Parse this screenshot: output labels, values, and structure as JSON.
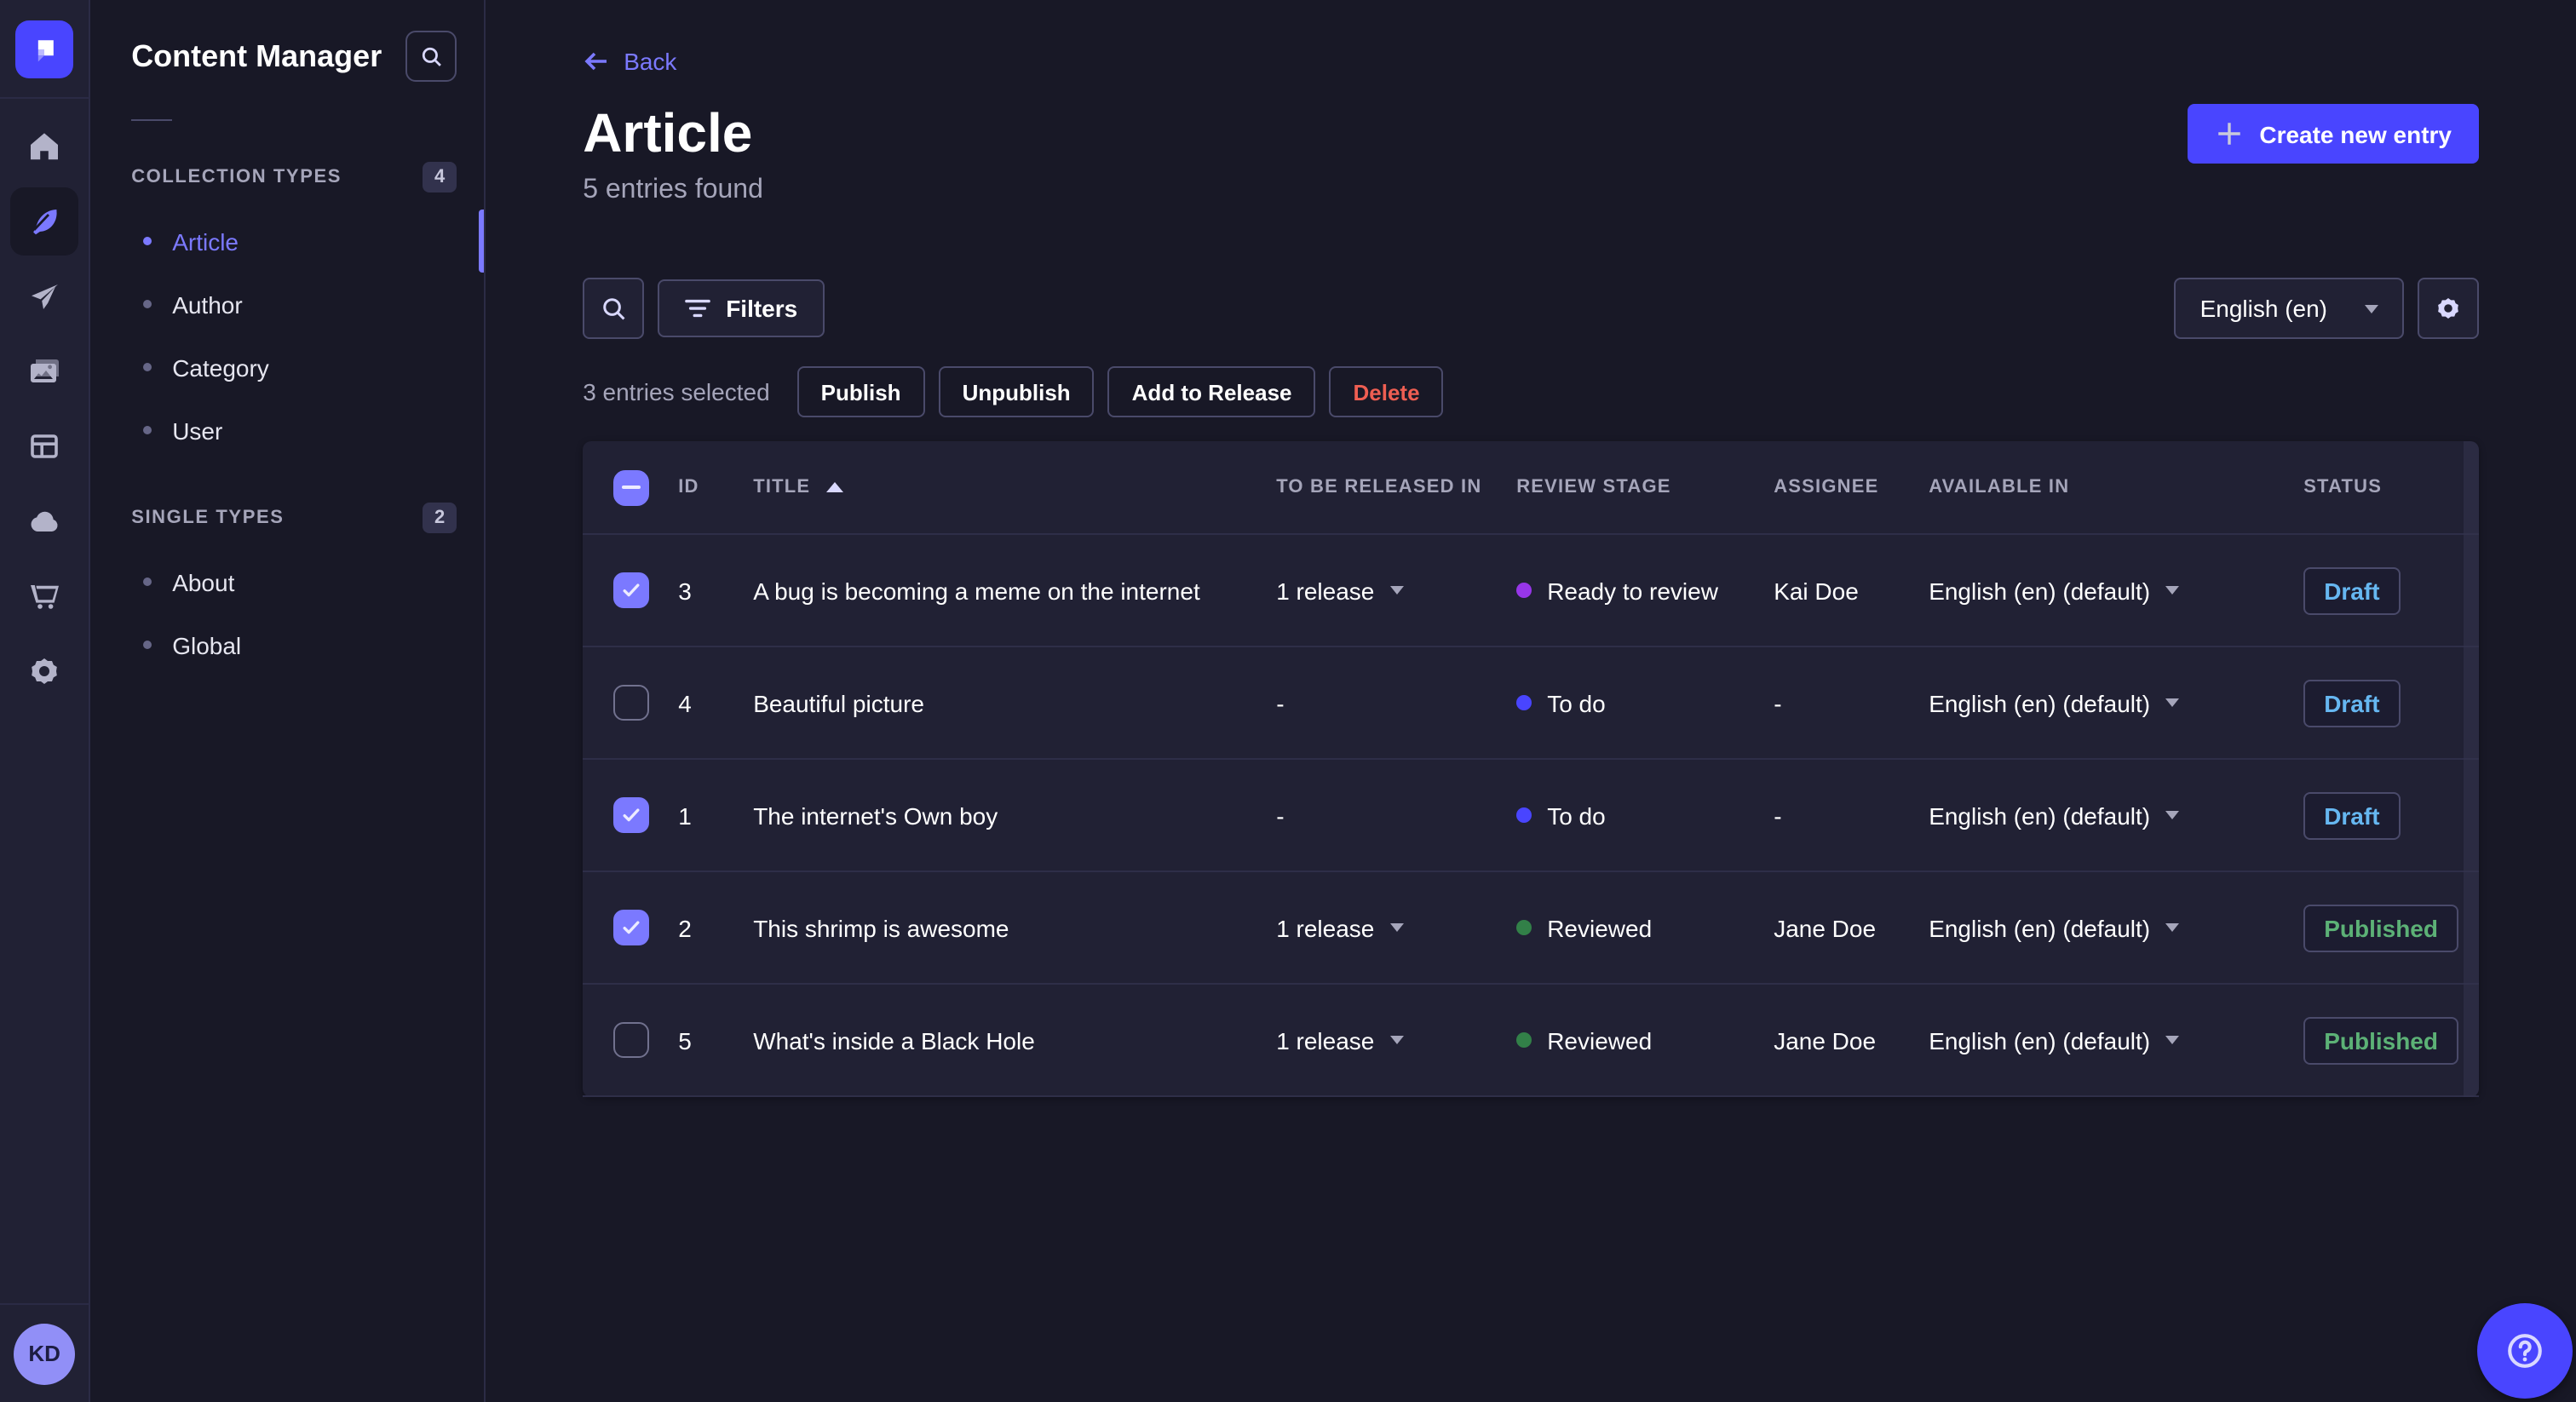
{
  "app": {
    "colors": {
      "primary": "#4945ff",
      "primary_light": "#7b79ff",
      "page_bg": "#181826",
      "panel_bg": "#212134",
      "border": "#32324d",
      "text_muted": "#a5a5ba",
      "danger": "#ee5e52",
      "draft_text": "#66b7f1",
      "published_text": "#5cb176",
      "stage_todo": "#4945ff",
      "stage_ready_to_review": "#9736e8",
      "stage_reviewed": "#328048"
    }
  },
  "rail": {
    "icons": [
      "strapi-logo",
      "home",
      "feather-content",
      "paper-plane",
      "media-library",
      "layout-builder",
      "cloud",
      "marketplace-cart",
      "settings-gear"
    ],
    "active_icon": "feather-content",
    "avatar_initials": "KD"
  },
  "sidebar": {
    "title": "Content Manager",
    "search_icon": "search",
    "groups": [
      {
        "label": "COLLECTION TYPES",
        "count": "4",
        "items": [
          {
            "label": "Article",
            "active": "true"
          },
          {
            "label": "Author",
            "active": "false"
          },
          {
            "label": "Category",
            "active": "false"
          },
          {
            "label": "User",
            "active": "false"
          }
        ]
      },
      {
        "label": "SINGLE TYPES",
        "count": "2",
        "items": [
          {
            "label": "About",
            "active": "false"
          },
          {
            "label": "Global",
            "active": "false"
          }
        ]
      }
    ]
  },
  "header": {
    "back_label": "Back",
    "title": "Article",
    "subtitle": "5 entries found",
    "create_button": "Create new entry"
  },
  "toolbar": {
    "filters_label": "Filters",
    "locale_value": "English (en)"
  },
  "selection": {
    "summary": "3 entries selected",
    "publish": "Publish",
    "unpublish": "Unpublish",
    "add_to_release": "Add to Release",
    "delete": "Delete"
  },
  "table": {
    "columns": [
      "ID",
      "TITLE",
      "TO BE RELEASED IN",
      "REVIEW STAGE",
      "ASSIGNEE",
      "AVAILABLE IN",
      "STATUS"
    ],
    "sorted_column": "TITLE",
    "sort_direction": "asc",
    "select_all_state": "indeterminate",
    "rows": [
      {
        "selected": "true",
        "id": "3",
        "title": "A bug is becoming a meme on the internet",
        "released": "1 release",
        "has_release": "true",
        "stage": "Ready to review",
        "assignee": "Kai Doe",
        "available": "English (en) (default)",
        "status": "Draft"
      },
      {
        "selected": "false",
        "id": "4",
        "title": "Beautiful picture",
        "released": "-",
        "has_release": "false",
        "stage": "To do",
        "assignee": "-",
        "available": "English (en) (default)",
        "status": "Draft"
      },
      {
        "selected": "true",
        "id": "1",
        "title": "The internet's Own boy",
        "released": "-",
        "has_release": "false",
        "stage": "To do",
        "assignee": "-",
        "available": "English (en) (default)",
        "status": "Draft"
      },
      {
        "selected": "true",
        "id": "2",
        "title": "This shrimp is awesome",
        "released": "1 release",
        "has_release": "true",
        "stage": "Reviewed",
        "assignee": "Jane Doe",
        "available": "English (en) (default)",
        "status": "Published"
      },
      {
        "selected": "false",
        "id": "5",
        "title": "What's inside a Black Hole",
        "released": "1 release",
        "has_release": "true",
        "stage": "Reviewed",
        "assignee": "Jane Doe",
        "available": "English (en) (default)",
        "status": "Published"
      }
    ]
  },
  "help": {
    "icon": "question-circle"
  }
}
